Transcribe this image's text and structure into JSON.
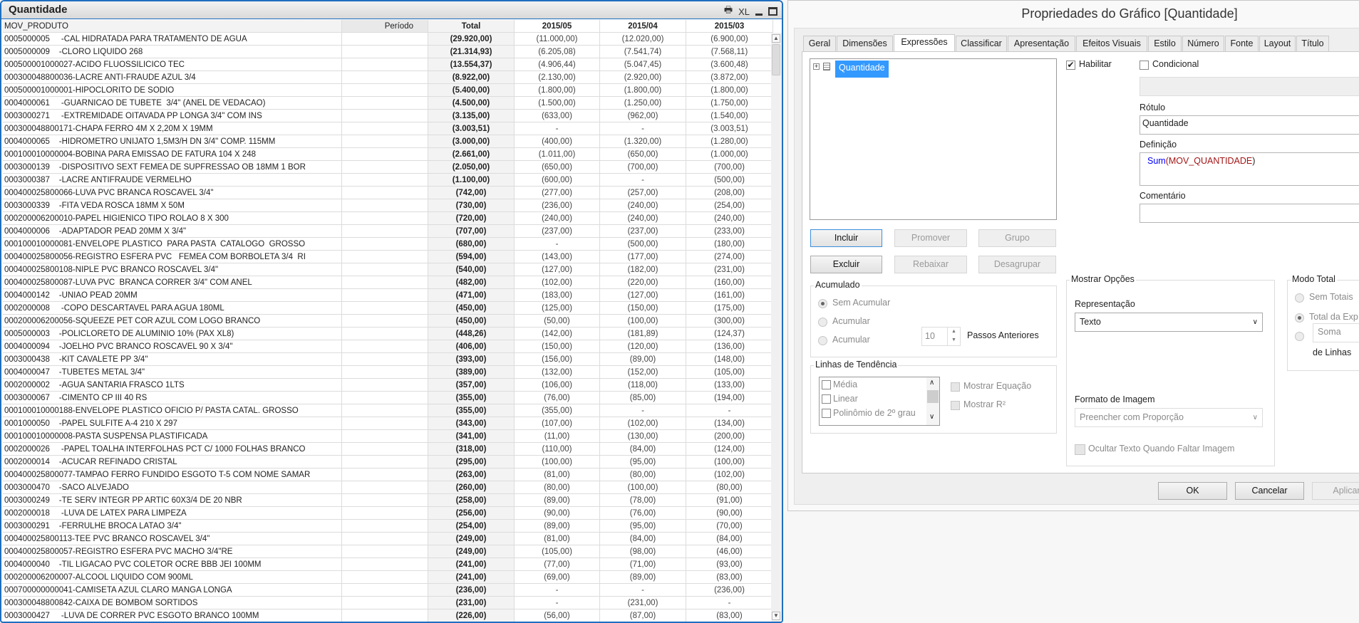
{
  "panel": {
    "title": "Quantidade",
    "icons": {
      "print": "printer-icon",
      "xl": "XL",
      "minimize": "minimize-icon",
      "maximize": "maximize-icon"
    },
    "columns": [
      "MOV_PRODUTO",
      "Período",
      "Total",
      "2015/05",
      "2015/04",
      "2015/03"
    ],
    "rows": [
      [
        "0005000005     -CAL HIDRATADA PARA TRATAMENTO DE AGUA",
        "(29.920,00)",
        "(11.000,00)",
        "(12.020,00)",
        "(6.900,00)"
      ],
      [
        "0005000009    -CLORO LIQUIDO 268",
        "(21.314,93)",
        "(6.205,08)",
        "(7.541,74)",
        "(7.568,11)"
      ],
      [
        "000500001000027-ACIDO FLUOSSILICICO TEC",
        "(13.554,37)",
        "(4.906,44)",
        "(5.047,45)",
        "(3.600,48)"
      ],
      [
        "000300048800036-LACRE ANTI-FRAUDE AZUL 3/4",
        "(8.922,00)",
        "(2.130,00)",
        "(2.920,00)",
        "(3.872,00)"
      ],
      [
        "000500001000001-HIPOCLORITO DE SODIO",
        "(5.400,00)",
        "(1.800,00)",
        "(1.800,00)",
        "(1.800,00)"
      ],
      [
        "0004000061     -GUARNICAO DE TUBETE  3/4\" (ANEL DE VEDACAO)",
        "(4.500,00)",
        "(1.500,00)",
        "(1.250,00)",
        "(1.750,00)"
      ],
      [
        "0003000271     -EXTREMIDADE OITAVADA PP LONGA 3/4\" COM INS",
        "(3.135,00)",
        "(633,00)",
        "(962,00)",
        "(1.540,00)"
      ],
      [
        "000300048800171-CHAPA FERRO 4M X 2,20M X 19MM",
        "(3.003,51)",
        "-",
        "-",
        "(3.003,51)"
      ],
      [
        "0004000065    -HIDROMETRO UNIJATO 1,5M3/H DN 3/4\" COMP. 115MM",
        "(3.000,00)",
        "(400,00)",
        "(1.320,00)",
        "(1.280,00)"
      ],
      [
        "000100010000004-BOBINA PARA EMISSAO DE FATURA 104 X 248",
        "(2.661,00)",
        "(1.011,00)",
        "(650,00)",
        "(1.000,00)"
      ],
      [
        "0003000139    -DISPOSITIVO SEXT FEMEA DE SUPFRESSAO OB 18MM 1 BOR",
        "(2.050,00)",
        "(650,00)",
        "(700,00)",
        "(700,00)"
      ],
      [
        "0003000387    -LACRE ANTIFRAUDE VERMELHO",
        "(1.100,00)",
        "(600,00)",
        "-",
        "(500,00)"
      ],
      [
        "000400025800066-LUVA PVC BRANCA ROSCAVEL 3/4\"",
        "(742,00)",
        "(277,00)",
        "(257,00)",
        "(208,00)"
      ],
      [
        "0003000339    -FITA VEDA ROSCA 18MM X 50M",
        "(730,00)",
        "(236,00)",
        "(240,00)",
        "(254,00)"
      ],
      [
        "000200006200010-PAPEL HIGIENICO TIPO ROLAO 8 X 300",
        "(720,00)",
        "(240,00)",
        "(240,00)",
        "(240,00)"
      ],
      [
        "0004000006    -ADAPTADOR PEAD 20MM X 3/4\"",
        "(707,00)",
        "(237,00)",
        "(237,00)",
        "(233,00)"
      ],
      [
        "000100010000081-ENVELOPE PLASTICO  PARA PASTA  CATALOGO  GROSSO",
        "(680,00)",
        "-",
        "(500,00)",
        "(180,00)"
      ],
      [
        "000400025800056-REGISTRO ESFERA PVC   FEMEA COM BORBOLETA 3/4  RI",
        "(594,00)",
        "(143,00)",
        "(177,00)",
        "(274,00)"
      ],
      [
        "000400025800108-NIPLE PVC BRANCO ROSCAVEL 3/4\"",
        "(540,00)",
        "(127,00)",
        "(182,00)",
        "(231,00)"
      ],
      [
        "000400025800087-LUVA PVC  BRANCA CORRER 3/4\" COM ANEL",
        "(482,00)",
        "(102,00)",
        "(220,00)",
        "(160,00)"
      ],
      [
        "0004000142    -UNIAO PEAD 20MM",
        "(471,00)",
        "(183,00)",
        "(127,00)",
        "(161,00)"
      ],
      [
        "0002000008     -COPO DESCARTAVEL PARA AGUA 180ML",
        "(450,00)",
        "(125,00)",
        "(150,00)",
        "(175,00)"
      ],
      [
        "000200006200056-SQUEEZE PET COR AZUL COM LOGO BRANCO",
        "(450,00)",
        "(50,00)",
        "(100,00)",
        "(300,00)"
      ],
      [
        "0005000003    -POLICLORETO DE ALUMINIO 10% (PAX XL8)",
        "(448,26)",
        "(142,00)",
        "(181,89)",
        "(124,37)"
      ],
      [
        "0004000094    -JOELHO PVC BRANCO ROSCAVEL 90 X 3/4\"",
        "(406,00)",
        "(150,00)",
        "(120,00)",
        "(136,00)"
      ],
      [
        "0003000438    -KIT CAVALETE PP 3/4\"",
        "(393,00)",
        "(156,00)",
        "(89,00)",
        "(148,00)"
      ],
      [
        "0004000047    -TUBETES METAL 3/4\"",
        "(389,00)",
        "(132,00)",
        "(152,00)",
        "(105,00)"
      ],
      [
        "0002000002    -AGUA SANTARIA FRASCO 1LTS",
        "(357,00)",
        "(106,00)",
        "(118,00)",
        "(133,00)"
      ],
      [
        "0003000067    -CIMENTO CP III 40 RS",
        "(355,00)",
        "(76,00)",
        "(85,00)",
        "(194,00)"
      ],
      [
        "000100010000188-ENVELOPE PLASTICO OFICIO P/ PASTA CATAL. GROSSO",
        "(355,00)",
        "(355,00)",
        "-",
        "-"
      ],
      [
        "0001000050    -PAPEL SULFITE A-4 210 X 297",
        "(343,00)",
        "(107,00)",
        "(102,00)",
        "(134,00)"
      ],
      [
        "000100010000008-PASTA SUSPENSA PLASTIFICADA",
        "(341,00)",
        "(11,00)",
        "(130,00)",
        "(200,00)"
      ],
      [
        "0002000026     -PAPEL TOALHA INTERFOLHAS PCT C/ 1000 FOLHAS BRANCO",
        "(318,00)",
        "(110,00)",
        "(84,00)",
        "(124,00)"
      ],
      [
        "0002000014    -ACUCAR REFINADO CRISTAL",
        "(295,00)",
        "(100,00)",
        "(95,00)",
        "(100,00)"
      ],
      [
        "000400025800077-TAMPAO FERRO FUNDIDO ESGOTO T-5 COM NOME SAMAR",
        "(263,00)",
        "(81,00)",
        "(80,00)",
        "(102,00)"
      ],
      [
        "0003000470    -SACO ALVEJADO",
        "(260,00)",
        "(80,00)",
        "(100,00)",
        "(80,00)"
      ],
      [
        "0003000249    -TE SERV INTEGR PP ARTIC 60X3/4 DE 20 NBR",
        "(258,00)",
        "(89,00)",
        "(78,00)",
        "(91,00)"
      ],
      [
        "0002000018     -LUVA DE LATEX PARA LIMPEZA",
        "(256,00)",
        "(90,00)",
        "(76,00)",
        "(90,00)"
      ],
      [
        "0003000291    -FERRULHE BROCA LATAO 3/4\"",
        "(254,00)",
        "(89,00)",
        "(95,00)",
        "(70,00)"
      ],
      [
        "000400025800113-TEE PVC BRANCO ROSCAVEL 3/4\"",
        "(249,00)",
        "(81,00)",
        "(84,00)",
        "(84,00)"
      ],
      [
        "000400025800057-REGISTRO ESFERA PVC MACHO 3/4\"RE",
        "(249,00)",
        "(105,00)",
        "(98,00)",
        "(46,00)"
      ],
      [
        "0004000040    -TIL LIGACAO PVC COLETOR OCRE BBB JEI 100MM",
        "(241,00)",
        "(77,00)",
        "(71,00)",
        "(93,00)"
      ],
      [
        "000200006200007-ALCOOL LIQUIDO COM 900ML",
        "(241,00)",
        "(69,00)",
        "(89,00)",
        "(83,00)"
      ],
      [
        "000700000000041-CAMISETA AZUL CLARO MANGA LONGA",
        "(236,00)",
        "-",
        "-",
        "(236,00)"
      ],
      [
        "000300048800842-CAIXA DE BOMBOM SORTIDOS",
        "(231,00)",
        "-",
        "(231,00)",
        "-"
      ],
      [
        "0003000427     -LUVA DE CORRER PVC ESGOTO BRANCO 100MM",
        "(226,00)",
        "(56,00)",
        "(87,00)",
        "(83,00)"
      ]
    ]
  },
  "dialog": {
    "title": "Propriedades do Gráfico [Quantidade]",
    "tabs": [
      "Geral",
      "Dimensões",
      "Expressões",
      "Classificar",
      "Apresentação",
      "Efeitos Visuais",
      "Estilo",
      "Número",
      "Fonte",
      "Layout",
      "Título"
    ],
    "active_tab": "Expressões",
    "tree_item": "Quantidade",
    "habilitar": {
      "label": "Habilitar",
      "checked": true
    },
    "condicional": {
      "label": "Condicional",
      "checked": false
    },
    "rotulo": {
      "label": "Rótulo",
      "value": "Quantidade"
    },
    "definicao": {
      "label": "Definição",
      "func": "Sum",
      "open": "(",
      "field": "MOV_QUANTIDADE",
      "close": ")",
      "func_color": "#0000ff",
      "field_color": "#a31515"
    },
    "comentario": {
      "label": "Comentário",
      "value": ""
    },
    "buttons": {
      "incluir": "Incluir",
      "promover": "Promover",
      "grupo": "Grupo",
      "excluir": "Excluir",
      "rebaixar": "Rebaixar",
      "desagrupar": "Desagrupar"
    },
    "acumulado": {
      "legend": "Acumulado",
      "opt1": "Sem Acumular",
      "opt2": "Acumular",
      "opt3": "Acumular",
      "steps": "10",
      "steps_label": "Passos Anteriores",
      "selected": "Sem Acumular"
    },
    "tendencia": {
      "legend": "Linhas de Tendência",
      "items": [
        "Média",
        "Linear",
        "Polinômio de 2º grau"
      ],
      "show_eq": "Mostrar Equação",
      "show_r2": "Mostrar R²"
    },
    "mostrar": {
      "legend": "Mostrar Opções",
      "rep_label": "Representação",
      "rep_value": "Texto",
      "img_label": "Formato de Imagem",
      "img_value": "Preencher com Proporção",
      "hide_text": "Ocultar Texto Quando Faltar Imagem"
    },
    "modo_total": {
      "legend": "Modo Total",
      "opt1": "Sem Totais",
      "opt2": "Total da Exp",
      "opt3_value": "Soma",
      "de_linhas": "de Linhas",
      "selected": "Total da Exp"
    },
    "footer": {
      "ok": "OK",
      "cancel": "Cancelar",
      "apply": "Aplicar"
    },
    "selection_color": "#3399ff"
  }
}
